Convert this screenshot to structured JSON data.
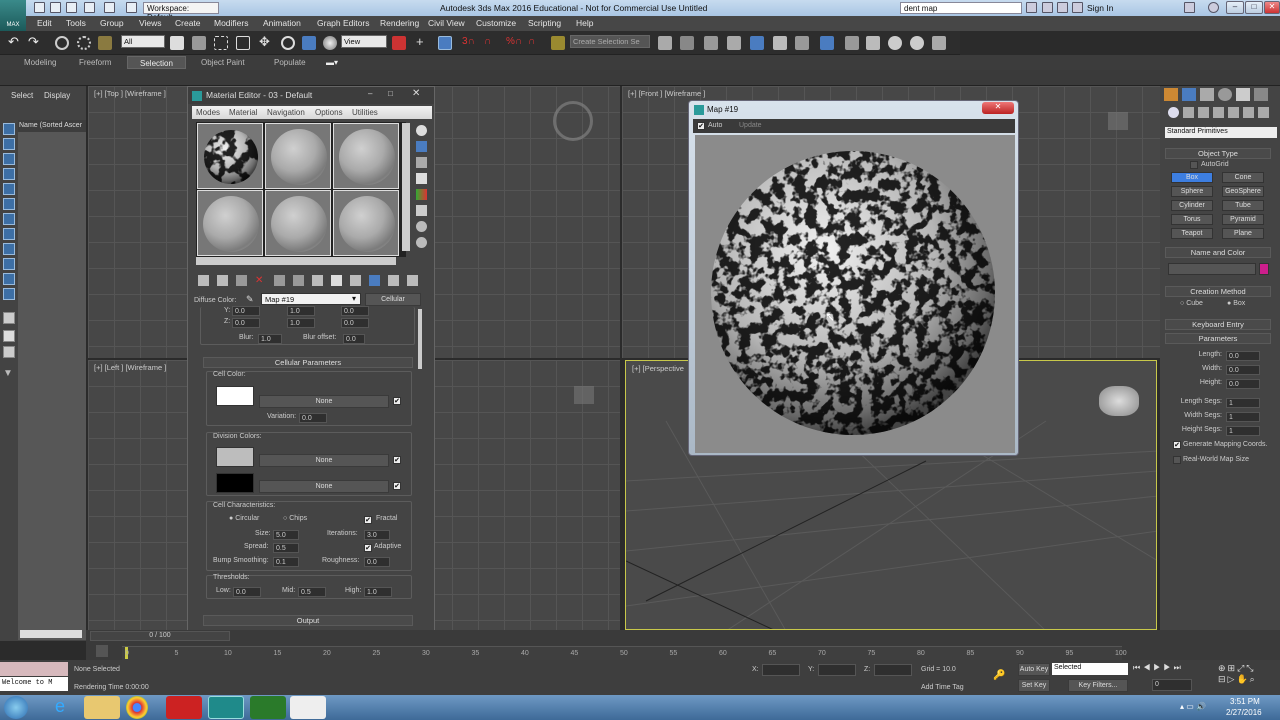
{
  "app": {
    "title": "Autodesk 3ds Max 2016 Educational - Not for Commercial Use   Untitled",
    "workspace": "Workspace: Default",
    "search_value": "dent map",
    "sign_in": "Sign In",
    "logo": "MAX"
  },
  "menu": [
    "Edit",
    "Tools",
    "Group",
    "Views",
    "Create",
    "Modifiers",
    "Animation",
    "Graph Editors",
    "Rendering",
    "Civil View",
    "Customize",
    "Scripting",
    "Help"
  ],
  "toolbar": {
    "selection_filter": "All",
    "ref_coord": "View",
    "selection_set_placeholder": "Create Selection Se"
  },
  "ribbon_tabs": [
    "Modeling",
    "Freeform",
    "Selection",
    "Object Paint",
    "Populate"
  ],
  "ribbon_active": "Selection",
  "explorer": {
    "tabs": [
      "Select",
      "Display"
    ],
    "column": "Name (Sorted Ascer"
  },
  "viewports": {
    "top": "[+] [Top ] [Wireframe ]",
    "front": "[+] [Front ] [Wireframe ]",
    "left": "[+] [Left ] [Wireframe ]",
    "perspective": "[+] [Perspective"
  },
  "material_editor": {
    "title": "Material Editor - 03 - Default",
    "menu": [
      "Modes",
      "Material",
      "Navigation",
      "Options",
      "Utilities"
    ],
    "diffuse_label": "Diffuse Color:",
    "map_name": "Map #19",
    "map_type": "Cellular",
    "coords": {
      "y_row": [
        "0.0",
        "1.0",
        "0.0"
      ],
      "z_label": "Z:",
      "z_row": [
        "0.0",
        "1.0",
        "0.0"
      ],
      "blur_label": "Blur:",
      "blur": "1.0",
      "blur_offset_label": "Blur offset:",
      "blur_offset": "0.0"
    },
    "cellular": {
      "header": "Cellular Parameters",
      "cell_color_label": "Cell Color:",
      "none": "None",
      "variation_label": "Variation:",
      "variation": "0.0",
      "division_label": "Division Colors:",
      "characteristics_label": "Cell Characteristics:",
      "circular": "Circular",
      "chips": "Chips",
      "fractal": "Fractal",
      "size_label": "Size:",
      "size": "5.0",
      "spread_label": "Spread:",
      "spread": "0.5",
      "bump_label": "Bump Smoothing:",
      "bump": "0.1",
      "iterations_label": "Iterations:",
      "iterations": "3.0",
      "adaptive": "Adaptive",
      "roughness_label": "Roughness:",
      "roughness": "0.0",
      "thresholds_label": "Thresholds:",
      "low_label": "Low:",
      "low": "0.0",
      "mid_label": "Mid:",
      "mid": "0.5",
      "high_label": "High:",
      "high": "1.0"
    },
    "output": "Output"
  },
  "map_window": {
    "title": "Map #19",
    "auto": "Auto",
    "update": "Update"
  },
  "command_panel": {
    "category": "Standard Primitives",
    "object_type": "Object Type",
    "autogrid": "AutoGrid",
    "buttons": [
      "Box",
      "Cone",
      "Sphere",
      "GeoSphere",
      "Cylinder",
      "Tube",
      "Torus",
      "Pyramid",
      "Teapot",
      "Plane"
    ],
    "name_color": "Name and Color",
    "object_color": "#cc1e8c",
    "creation_method": "Creation Method",
    "cube": "Cube",
    "box": "Box",
    "keyboard_entry": "Keyboard Entry",
    "parameters": "Parameters",
    "params": [
      {
        "label": "Length:",
        "value": "0.0"
      },
      {
        "label": "Width:",
        "value": "0.0"
      },
      {
        "label": "Height:",
        "value": "0.0"
      },
      {
        "label": "Length Segs:",
        "value": "1"
      },
      {
        "label": "Width Segs:",
        "value": "1"
      },
      {
        "label": "Height Segs:",
        "value": "1"
      }
    ],
    "gen_mapping": "Generate Mapping Coords.",
    "real_world": "Real-World Map Size"
  },
  "timeline": {
    "frame": "0 / 100",
    "ticks": [
      "0",
      "5",
      "10",
      "15",
      "20",
      "25",
      "30",
      "35",
      "40",
      "45",
      "50",
      "55",
      "60",
      "65",
      "70",
      "75",
      "80",
      "85",
      "90",
      "95",
      "100"
    ]
  },
  "status": {
    "selected": "None Selected",
    "render_time": "Rendering Time  0:00:00",
    "welcome": "Welcome to M",
    "x": "X:",
    "y": "Y:",
    "z": "Z:",
    "grid": "Grid = 10.0",
    "add_time_tag": "Add Time Tag",
    "auto_key": "Auto Key",
    "set_key": "Set Key",
    "key_mode": "Selected",
    "key_filters": "Key Filters...",
    "frame_value": "0"
  },
  "taskbar": {
    "time": "3:51 PM",
    "date": "2/27/2016"
  }
}
